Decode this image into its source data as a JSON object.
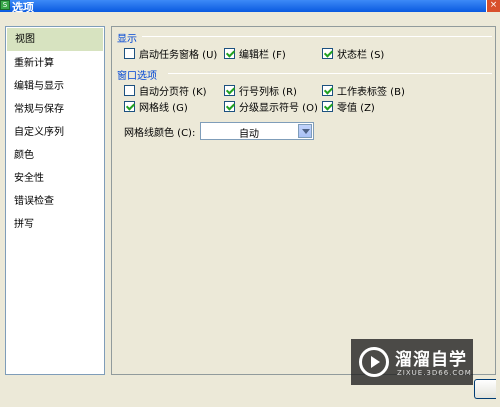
{
  "window": {
    "title": "选项",
    "app_icon_glyph": "S",
    "close_glyph": "×"
  },
  "categories": [
    {
      "label": "视图"
    },
    {
      "label": "重新计算"
    },
    {
      "label": "编辑与显示"
    },
    {
      "label": "常规与保存"
    },
    {
      "label": "自定义序列"
    },
    {
      "label": "颜色"
    },
    {
      "label": "安全性"
    },
    {
      "label": "错误检查"
    },
    {
      "label": "拼写"
    }
  ],
  "selected_category": "视图",
  "display_group": {
    "title": "显示",
    "options": [
      {
        "label": "启动任务窗格 (U)",
        "checked": false
      },
      {
        "label": "编辑栏 (F)",
        "checked": true
      },
      {
        "label": "状态栏 (S)",
        "checked": true
      }
    ]
  },
  "window_group": {
    "title": "窗口选项",
    "options": [
      {
        "label": "自动分页符 (K)",
        "checked": false
      },
      {
        "label": "行号列标 (R)",
        "checked": true
      },
      {
        "label": "工作表标签 (B)",
        "checked": true
      },
      {
        "label": "网格线 (G)",
        "checked": true
      },
      {
        "label": "分级显示符号 (O)",
        "checked": true
      },
      {
        "label": "零值 (Z)",
        "checked": true
      }
    ]
  },
  "gridline_color": {
    "label": "网格线颜色 (C):",
    "value": "自动"
  },
  "watermark": {
    "brand": "溜溜自学",
    "url": "ZIXUE.3D66.COM"
  },
  "colors": {
    "accent_text": "#0046d5",
    "check_mark": "#21a121",
    "selected_bg": "#d7e3c0"
  }
}
